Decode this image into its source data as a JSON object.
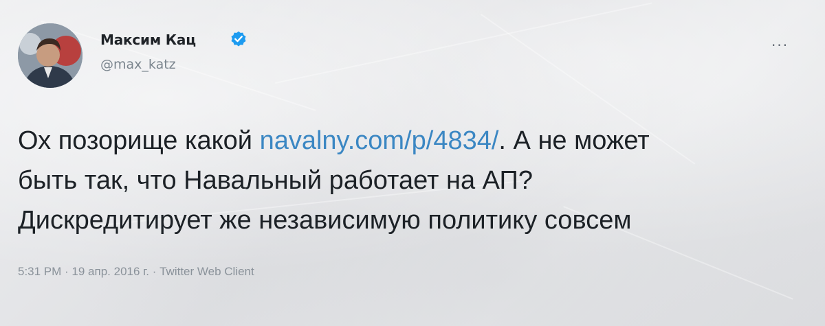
{
  "tweet": {
    "display_name": "Максим Кац",
    "handle": "@max_katz",
    "more_glyph": "...",
    "text_line1_before_link": "Ох позорище какой ",
    "link_text": "navalny.com/p/4834/",
    "text_line1_after_link": ". А не может",
    "text_line2": "быть так, что Навальный работает на АП?",
    "text_line3": "Дискредитирует же независимую политику совсем",
    "timestamp": "5:31 PM · 19 апр. 2016 г. · Twitter Web Client"
  },
  "colors": {
    "link": "#3b87c3",
    "verified_badge": "#1d9bf0",
    "text": "#1c2126",
    "secondary_text": "#7b858e"
  },
  "icons": {
    "verified": "verified-badge-icon",
    "more": "more-options-icon"
  }
}
